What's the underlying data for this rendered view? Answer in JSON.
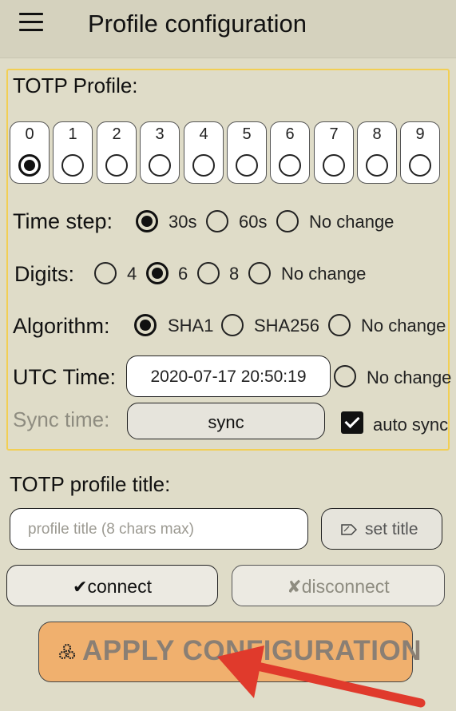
{
  "appbar": {
    "title": "Profile configuration"
  },
  "totp_panel": {
    "title": "TOTP Profile:",
    "profiles": [
      "0",
      "1",
      "2",
      "3",
      "4",
      "5",
      "6",
      "7",
      "8",
      "9"
    ],
    "selected_profile": "0",
    "time_step": {
      "label": "Time step:",
      "options": [
        "30s",
        "60s",
        "No change"
      ],
      "selected": "30s"
    },
    "digits": {
      "label": "Digits:",
      "options": [
        "4",
        "6",
        "8",
        "No change"
      ],
      "selected": "6"
    },
    "algorithm": {
      "label": "Algorithm:",
      "options": [
        "SHA1",
        "SHA256",
        "No change"
      ],
      "selected": "SHA1"
    },
    "utc_time": {
      "label": "UTC Time:",
      "value": "2020-07-17 20:50:19",
      "no_change_label": "No change"
    },
    "sync_time": {
      "label": "Sync time:",
      "button_label": "sync",
      "auto_sync_label": "auto sync",
      "auto_sync_checked": true
    }
  },
  "profile_title": {
    "heading": "TOTP profile title:",
    "placeholder": "profile title (8 chars max)",
    "set_title_label": "set title",
    "set_title_icon": "tag-icon"
  },
  "connection": {
    "connect_label": "connect",
    "connect_icon": "✔",
    "disconnect_label": "disconnect",
    "disconnect_icon": "✘"
  },
  "apply": {
    "label": "APPLY CONFIGURATION",
    "icon": "gears-icon"
  },
  "colors": {
    "background": "#dfdcc8",
    "panel_border": "#f2cf54",
    "apply_button": "#f0b06e",
    "annotation_arrow": "#e03a2c"
  }
}
